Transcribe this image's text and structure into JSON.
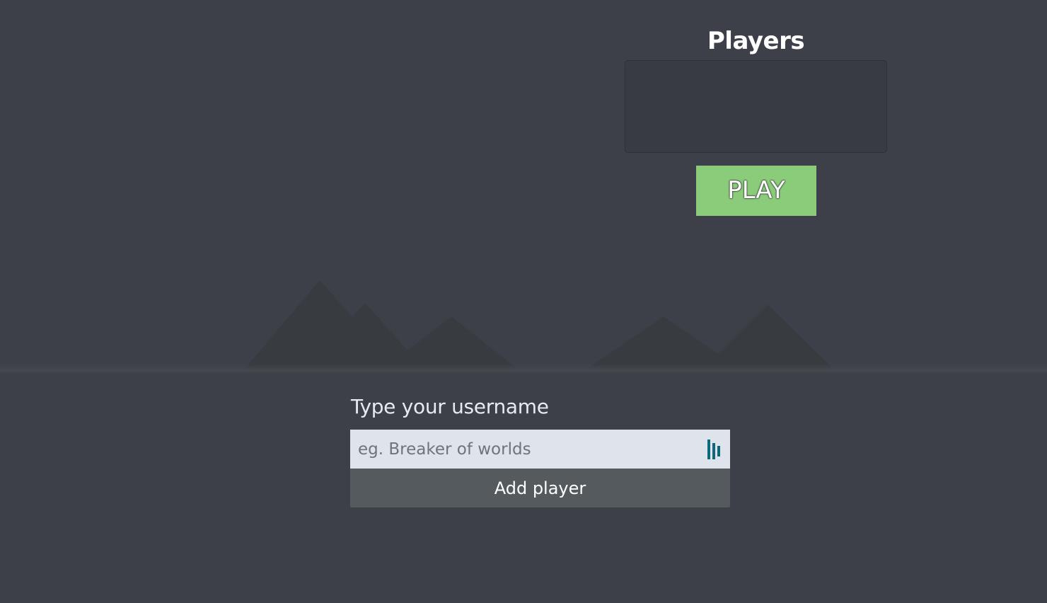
{
  "players": {
    "title": "Players",
    "list": []
  },
  "play_button": {
    "label": "PLAY"
  },
  "username": {
    "label": "Type your username",
    "value": "",
    "placeholder": "eg. Breaker of worlds"
  },
  "add_player_button": {
    "label": "Add player"
  },
  "icons": {
    "input_extension": "dashlane-icon"
  },
  "colors": {
    "background": "#3d4048",
    "play_button": "#8bcc7b",
    "add_player_button": "#555a5f",
    "input_background": "#dfe3ec",
    "mountains": "#383b40",
    "extension_icon": "#0e6a7a"
  }
}
